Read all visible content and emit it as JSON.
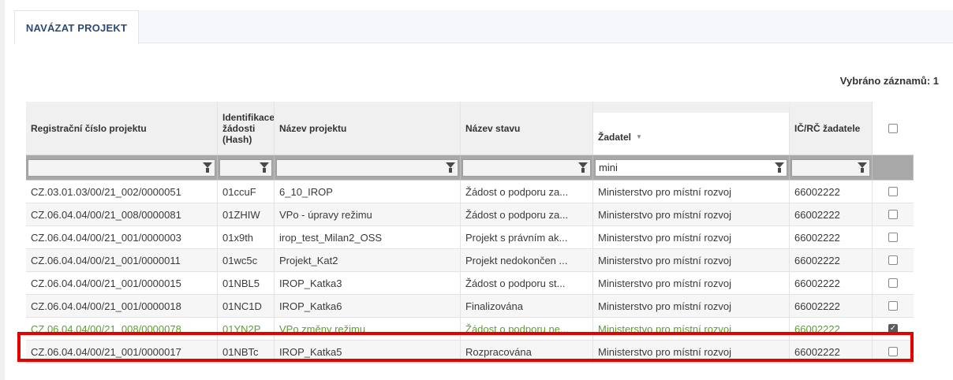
{
  "tab": {
    "label": "NAVÁZAT PROJEKT"
  },
  "selection_count": "Vybráno záznamů: 1",
  "columns": [
    "Registrační číslo projektu",
    "Identifikace žádosti (Hash)",
    "Název projektu",
    "Název stavu",
    "Žadatel",
    "IČ/RČ žadatele"
  ],
  "filters": {
    "zadatel": "mini"
  },
  "rows": [
    {
      "reg": "CZ.03.01.03/00/21_002/0000051",
      "hash": "01ccuF",
      "name": "6_10_IROP",
      "state": "Žádost o podporu za...",
      "applicant": "Ministerstvo pro místní rozvoj",
      "ic": "66002222",
      "checked": false
    },
    {
      "reg": "CZ.06.04.04/00/21_008/0000081",
      "hash": "01ZHIW",
      "name": "VPo - úpravy režimu",
      "state": "Žádost o podporu za...",
      "applicant": "Ministerstvo pro místní rozvoj",
      "ic": "66002222",
      "checked": false
    },
    {
      "reg": "CZ.06.04.04/00/21_001/0000003",
      "hash": "01x9th",
      "name": "irop_test_Milan2_OSS",
      "state": "Projekt s právním ak...",
      "applicant": "Ministerstvo pro místní rozvoj",
      "ic": "66002222",
      "checked": false
    },
    {
      "reg": "CZ.06.04.04/00/21_001/0000011",
      "hash": "01wc5c",
      "name": "Projekt_Kat2",
      "state": "Projekt nedokončen ...",
      "applicant": "Ministerstvo pro místní rozvoj",
      "ic": "66002222",
      "checked": false
    },
    {
      "reg": "CZ.06.04.04/00/21_001/0000015",
      "hash": "01NBL5",
      "name": "IROP_Katka3",
      "state": "Žádost o podporu st...",
      "applicant": "Ministerstvo pro místní rozvoj",
      "ic": "66002222",
      "checked": false
    },
    {
      "reg": "CZ.06.04.04/00/21_001/0000018",
      "hash": "01NC1D",
      "name": "IROP_Katka6",
      "state": "Finalizována",
      "applicant": "Ministerstvo pro místní rozvoj",
      "ic": "66002222",
      "checked": false
    },
    {
      "reg": "CZ.06.04.04/00/21_008/0000078",
      "hash": "01YN2P",
      "name": "VPo změny režimu",
      "state": "Žádost o podporu ne...",
      "applicant": "Ministerstvo pro místní rozvoj",
      "ic": "66002222",
      "checked": true
    },
    {
      "reg": "CZ.06.04.04/00/21_001/0000017",
      "hash": "01NBTc",
      "name": "IROP_Katka5",
      "state": "Rozpracována",
      "applicant": "Ministerstvo pro místní rozvoj",
      "ic": "66002222",
      "checked": false
    }
  ],
  "colors": {
    "selected_text": "#5f9d2f",
    "highlight_border": "#e80000",
    "tab_text": "#2c4a75"
  }
}
